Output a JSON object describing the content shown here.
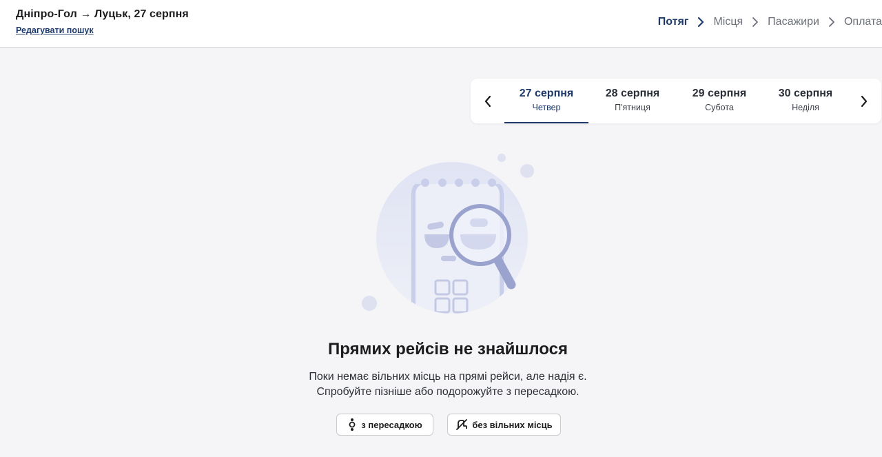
{
  "header": {
    "route": "Дніпро-Гол → Луцьк, 27 серпня",
    "edit_label": "Редагувати пошук",
    "steps": [
      "Потяг",
      "Місця",
      "Пасажири",
      "Оплата"
    ]
  },
  "dates": [
    {
      "date": "27 серпня",
      "weekday": "Четвер",
      "active": true
    },
    {
      "date": "28 серпня",
      "weekday": "П'ятниця",
      "active": false
    },
    {
      "date": "29 серпня",
      "weekday": "Субота",
      "active": false
    },
    {
      "date": "30 серпня",
      "weekday": "Неділя",
      "active": false
    }
  ],
  "empty": {
    "title": "Прямих рейсів не знайшлося",
    "line1": "Поки немає вільних місць на прямі рейси, але надія є.",
    "line2": "Спробуйте пізніше або подорожуйте з пересадкою."
  },
  "filters": {
    "transfer": "з пересадкою",
    "no_free": "без вільних місць"
  },
  "icons": {
    "step_separator": "chevron-right-icon",
    "prev": "chevron-left-icon",
    "next": "chevron-right-icon",
    "transfer": "transfer-icon",
    "no_free": "no-seats-icon"
  },
  "colors": {
    "accent": "#1d3a6b",
    "muted": "#6b6f78",
    "illustration": "#c9cfea"
  }
}
